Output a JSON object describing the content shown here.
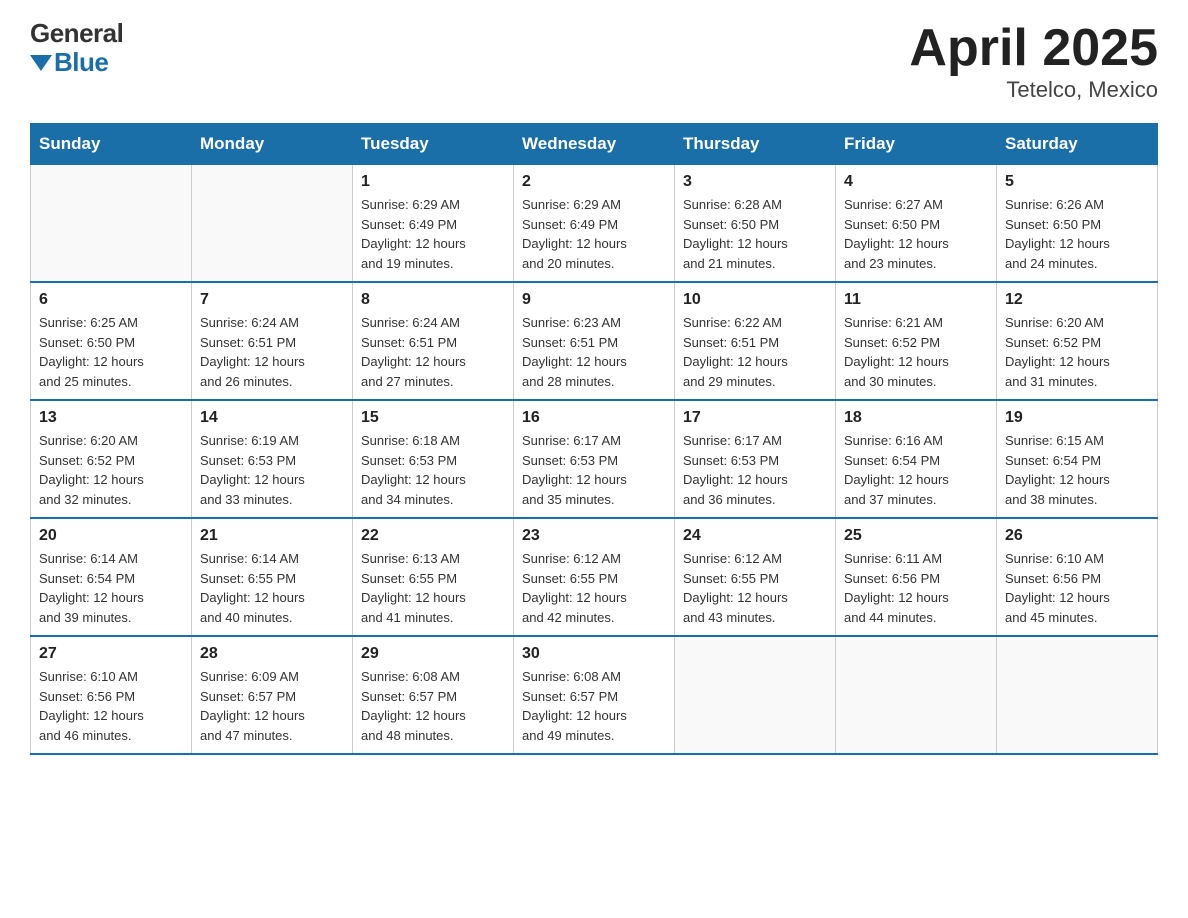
{
  "header": {
    "logo_general": "General",
    "logo_blue": "Blue",
    "title": "April 2025",
    "subtitle": "Tetelco, Mexico"
  },
  "weekdays": [
    "Sunday",
    "Monday",
    "Tuesday",
    "Wednesday",
    "Thursday",
    "Friday",
    "Saturday"
  ],
  "weeks": [
    [
      {
        "day": "",
        "info": ""
      },
      {
        "day": "",
        "info": ""
      },
      {
        "day": "1",
        "info": "Sunrise: 6:29 AM\nSunset: 6:49 PM\nDaylight: 12 hours\nand 19 minutes."
      },
      {
        "day": "2",
        "info": "Sunrise: 6:29 AM\nSunset: 6:49 PM\nDaylight: 12 hours\nand 20 minutes."
      },
      {
        "day": "3",
        "info": "Sunrise: 6:28 AM\nSunset: 6:50 PM\nDaylight: 12 hours\nand 21 minutes."
      },
      {
        "day": "4",
        "info": "Sunrise: 6:27 AM\nSunset: 6:50 PM\nDaylight: 12 hours\nand 23 minutes."
      },
      {
        "day": "5",
        "info": "Sunrise: 6:26 AM\nSunset: 6:50 PM\nDaylight: 12 hours\nand 24 minutes."
      }
    ],
    [
      {
        "day": "6",
        "info": "Sunrise: 6:25 AM\nSunset: 6:50 PM\nDaylight: 12 hours\nand 25 minutes."
      },
      {
        "day": "7",
        "info": "Sunrise: 6:24 AM\nSunset: 6:51 PM\nDaylight: 12 hours\nand 26 minutes."
      },
      {
        "day": "8",
        "info": "Sunrise: 6:24 AM\nSunset: 6:51 PM\nDaylight: 12 hours\nand 27 minutes."
      },
      {
        "day": "9",
        "info": "Sunrise: 6:23 AM\nSunset: 6:51 PM\nDaylight: 12 hours\nand 28 minutes."
      },
      {
        "day": "10",
        "info": "Sunrise: 6:22 AM\nSunset: 6:51 PM\nDaylight: 12 hours\nand 29 minutes."
      },
      {
        "day": "11",
        "info": "Sunrise: 6:21 AM\nSunset: 6:52 PM\nDaylight: 12 hours\nand 30 minutes."
      },
      {
        "day": "12",
        "info": "Sunrise: 6:20 AM\nSunset: 6:52 PM\nDaylight: 12 hours\nand 31 minutes."
      }
    ],
    [
      {
        "day": "13",
        "info": "Sunrise: 6:20 AM\nSunset: 6:52 PM\nDaylight: 12 hours\nand 32 minutes."
      },
      {
        "day": "14",
        "info": "Sunrise: 6:19 AM\nSunset: 6:53 PM\nDaylight: 12 hours\nand 33 minutes."
      },
      {
        "day": "15",
        "info": "Sunrise: 6:18 AM\nSunset: 6:53 PM\nDaylight: 12 hours\nand 34 minutes."
      },
      {
        "day": "16",
        "info": "Sunrise: 6:17 AM\nSunset: 6:53 PM\nDaylight: 12 hours\nand 35 minutes."
      },
      {
        "day": "17",
        "info": "Sunrise: 6:17 AM\nSunset: 6:53 PM\nDaylight: 12 hours\nand 36 minutes."
      },
      {
        "day": "18",
        "info": "Sunrise: 6:16 AM\nSunset: 6:54 PM\nDaylight: 12 hours\nand 37 minutes."
      },
      {
        "day": "19",
        "info": "Sunrise: 6:15 AM\nSunset: 6:54 PM\nDaylight: 12 hours\nand 38 minutes."
      }
    ],
    [
      {
        "day": "20",
        "info": "Sunrise: 6:14 AM\nSunset: 6:54 PM\nDaylight: 12 hours\nand 39 minutes."
      },
      {
        "day": "21",
        "info": "Sunrise: 6:14 AM\nSunset: 6:55 PM\nDaylight: 12 hours\nand 40 minutes."
      },
      {
        "day": "22",
        "info": "Sunrise: 6:13 AM\nSunset: 6:55 PM\nDaylight: 12 hours\nand 41 minutes."
      },
      {
        "day": "23",
        "info": "Sunrise: 6:12 AM\nSunset: 6:55 PM\nDaylight: 12 hours\nand 42 minutes."
      },
      {
        "day": "24",
        "info": "Sunrise: 6:12 AM\nSunset: 6:55 PM\nDaylight: 12 hours\nand 43 minutes."
      },
      {
        "day": "25",
        "info": "Sunrise: 6:11 AM\nSunset: 6:56 PM\nDaylight: 12 hours\nand 44 minutes."
      },
      {
        "day": "26",
        "info": "Sunrise: 6:10 AM\nSunset: 6:56 PM\nDaylight: 12 hours\nand 45 minutes."
      }
    ],
    [
      {
        "day": "27",
        "info": "Sunrise: 6:10 AM\nSunset: 6:56 PM\nDaylight: 12 hours\nand 46 minutes."
      },
      {
        "day": "28",
        "info": "Sunrise: 6:09 AM\nSunset: 6:57 PM\nDaylight: 12 hours\nand 47 minutes."
      },
      {
        "day": "29",
        "info": "Sunrise: 6:08 AM\nSunset: 6:57 PM\nDaylight: 12 hours\nand 48 minutes."
      },
      {
        "day": "30",
        "info": "Sunrise: 6:08 AM\nSunset: 6:57 PM\nDaylight: 12 hours\nand 49 minutes."
      },
      {
        "day": "",
        "info": ""
      },
      {
        "day": "",
        "info": ""
      },
      {
        "day": "",
        "info": ""
      }
    ]
  ]
}
